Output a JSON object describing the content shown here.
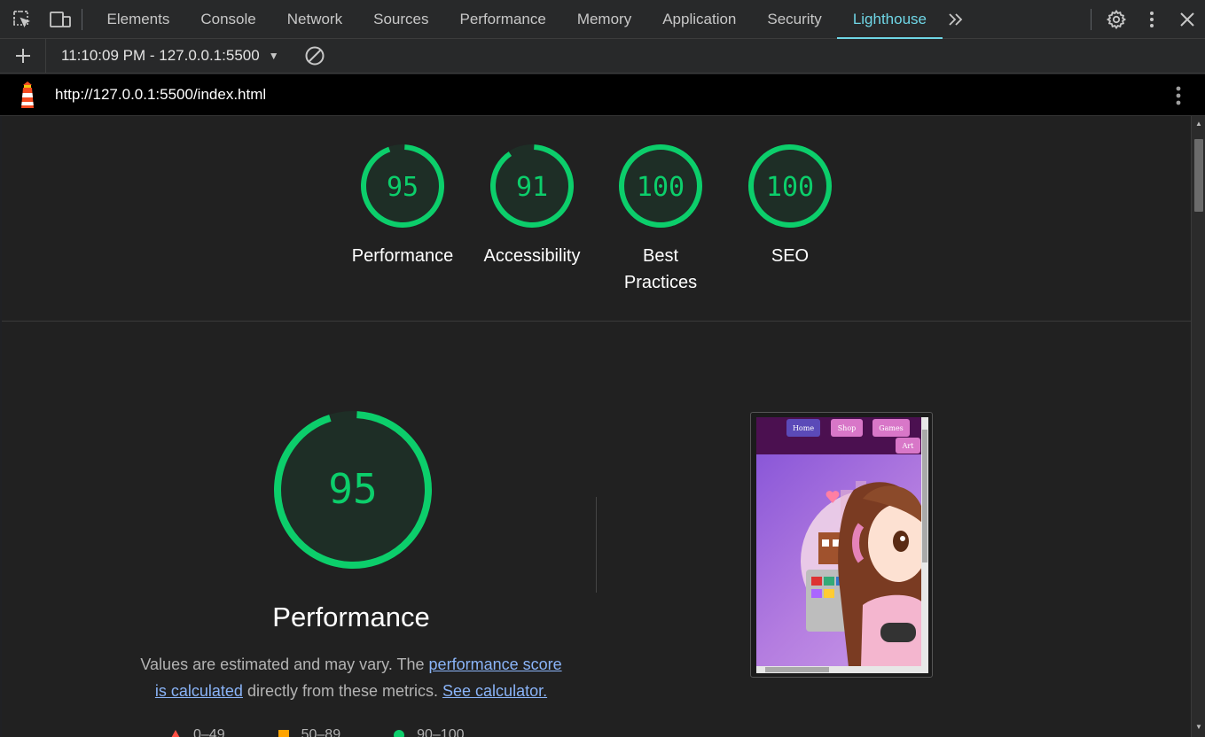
{
  "devtools": {
    "tabs": [
      {
        "label": "Elements"
      },
      {
        "label": "Console"
      },
      {
        "label": "Network"
      },
      {
        "label": "Sources"
      },
      {
        "label": "Performance"
      },
      {
        "label": "Memory"
      },
      {
        "label": "Application"
      },
      {
        "label": "Security"
      },
      {
        "label": "Lighthouse"
      }
    ],
    "active_tab": "Lighthouse",
    "icons": {
      "inspect": "inspect-element-icon",
      "device": "device-toolbar-icon",
      "more_tabs": "chevron-double-right-icon",
      "settings": "gear-icon",
      "menu": "kebab-menu-icon",
      "close": "close-icon"
    }
  },
  "report_toolbar": {
    "report_selector": "11:10:09 PM - 127.0.0.1:5500",
    "icons": {
      "new": "plus-icon",
      "caret": "caret-down-icon",
      "clear": "clear-icon"
    }
  },
  "url_bar": {
    "url": "http://127.0.0.1:5500/index.html",
    "icons": {
      "logo": "lighthouse-logo-icon",
      "menu": "kebab-menu-icon"
    }
  },
  "summary": {
    "gauges": [
      {
        "score": 95,
        "label": "Performance"
      },
      {
        "score": 91,
        "label": "Accessibility"
      },
      {
        "score": 100,
        "label": "Best Practices"
      },
      {
        "score": 100,
        "label": "SEO"
      }
    ]
  },
  "performance": {
    "score": 95,
    "title": "Performance",
    "desc_prefix": "Values are estimated and may vary. The ",
    "link_score": "performance score is calculated",
    "desc_middle": " directly from these metrics. ",
    "link_calc": "See calculator.",
    "legend": [
      {
        "range": "0–49",
        "icon": "triangle-icon"
      },
      {
        "range": "50–89",
        "icon": "square-icon"
      },
      {
        "range": "90–100",
        "icon": "circle-icon"
      }
    ]
  },
  "thumbnail": {
    "nav": [
      "Home",
      "Shop",
      "Games",
      "Art"
    ]
  },
  "colors": {
    "pass_green": "#0cce6b",
    "gauge_fill": "#1e2e26",
    "accent_cyan": "#6fd6e6",
    "link_blue": "#8ab4f8"
  }
}
